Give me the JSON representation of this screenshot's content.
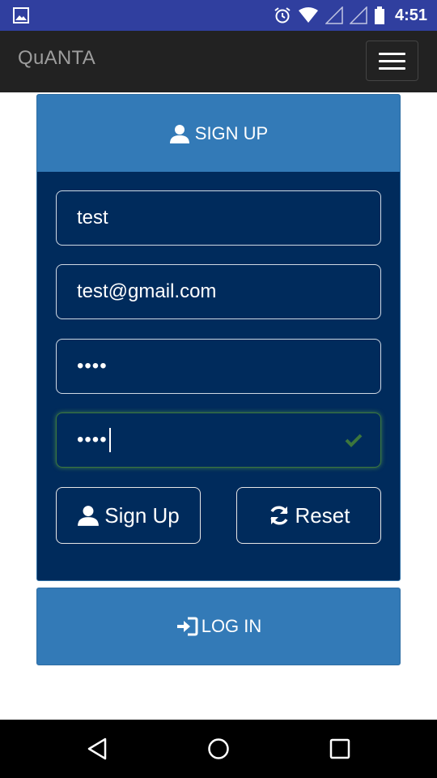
{
  "status_bar": {
    "time": "4:51",
    "icons": [
      "gallery-icon",
      "alarm-icon",
      "wifi-icon",
      "signal-icon",
      "signal-icon",
      "battery-icon"
    ],
    "background": "#303f9f"
  },
  "navbar": {
    "brand": "QuANTA",
    "menu_icon": "hamburger-menu-icon",
    "background": "#222222"
  },
  "signup": {
    "header_label": "SIGN UP",
    "header_icon": "user-icon",
    "fields": {
      "username": {
        "value": "test"
      },
      "email": {
        "value": "test@gmail.com"
      },
      "password": {
        "value": "••••"
      },
      "confirm_password": {
        "value": "••••",
        "state": "valid",
        "state_icon": "check-icon"
      }
    },
    "buttons": {
      "signup_label": "Sign Up",
      "signup_icon": "user-icon",
      "reset_label": "Reset",
      "reset_icon": "refresh-icon"
    },
    "colors": {
      "panel": "#002b5c",
      "header": "#337ab7",
      "valid": "#3c763d"
    }
  },
  "login": {
    "label": "LOG IN",
    "icon": "login-icon",
    "background": "#337ab7"
  },
  "android_nav": {
    "icons": [
      "back-icon",
      "home-icon",
      "recent-apps-icon"
    ]
  }
}
